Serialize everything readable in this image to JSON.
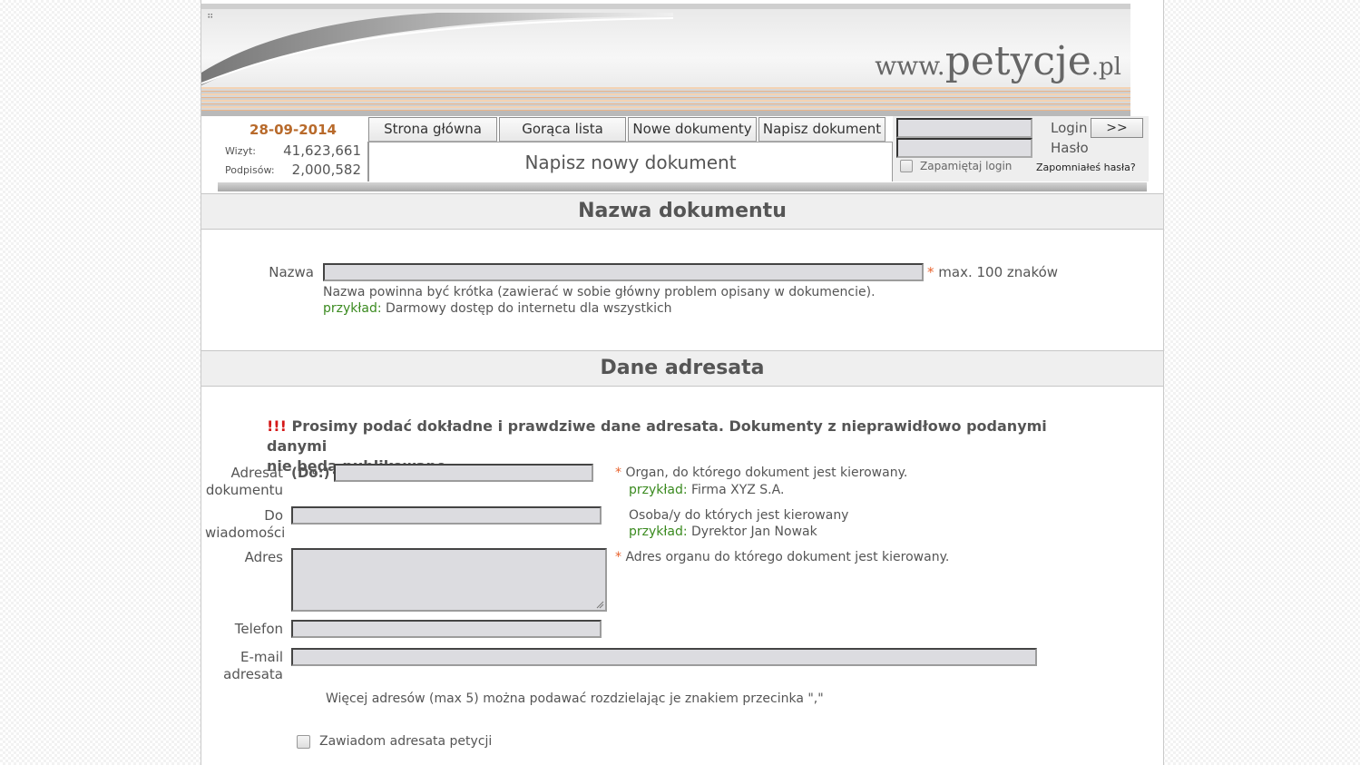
{
  "header": {
    "url_prefix": "www.",
    "url_name": "petycje",
    "url_tld": ".pl"
  },
  "nav": {
    "date": "28-09-2014",
    "stats": [
      {
        "label": "Wizyt:",
        "value": "41,623,661"
      },
      {
        "label": "Podpisów:",
        "value": "2,000,582"
      }
    ],
    "tabs": [
      "Strona główna",
      "Gorąca lista",
      "Nowe dokumenty",
      "Napisz dokument"
    ],
    "page_title": "Napisz nowy dokument"
  },
  "login": {
    "login_label": "Login",
    "password_label": "Hasło",
    "go_label": ">>",
    "remember_label": "Zapamiętaj login",
    "forgot_label": "Zapomniałeś hasła?"
  },
  "section_name": {
    "title": "Nazwa dokumentu",
    "field_label": "Nazwa",
    "required_mark": "*",
    "limit": "max. 100 znaków",
    "hint": "Nazwa powinna być krótka (zawierać w sobie główny problem opisany w dokumencie).",
    "example_label": "przykład:",
    "example_text": "Darmowy dostęp do internetu dla wszystkich"
  },
  "section_address": {
    "title": "Dane adresata",
    "warning_marks": "!!!",
    "warning_line1": "Prosimy podać dokładne i prawdziwe dane adresata. Dokumenty z nieprawidłowo podanymi danymi",
    "warning_line2": "nie będą publikowane.",
    "addressee_label_1": "Adresat",
    "addressee_label_2": "dokumentu",
    "addressee_prefix": "(Do:)",
    "addressee_hint": "Organ, do którego dokument jest kierowany.",
    "addressee_example": "Firma XYZ S.A.",
    "cc_label_1": "Do",
    "cc_label_2": "wiadomości",
    "cc_hint": "Osoba/y do których jest kierowany",
    "cc_example": "Dyrektor Jan Nowak",
    "address_label": "Adres",
    "address_hint": "Adres organu do którego dokument jest kierowany.",
    "phone_label": "Telefon",
    "email_label_1": "E-mail",
    "email_label_2": "adresata",
    "email_note": "Więcej adresów (max 5) można podawać rozdzielając je znakiem przecinka \",\"",
    "notify_label": "Zawiadom adresata petycji",
    "example_label": "przykład:",
    "required_mark": "*"
  }
}
